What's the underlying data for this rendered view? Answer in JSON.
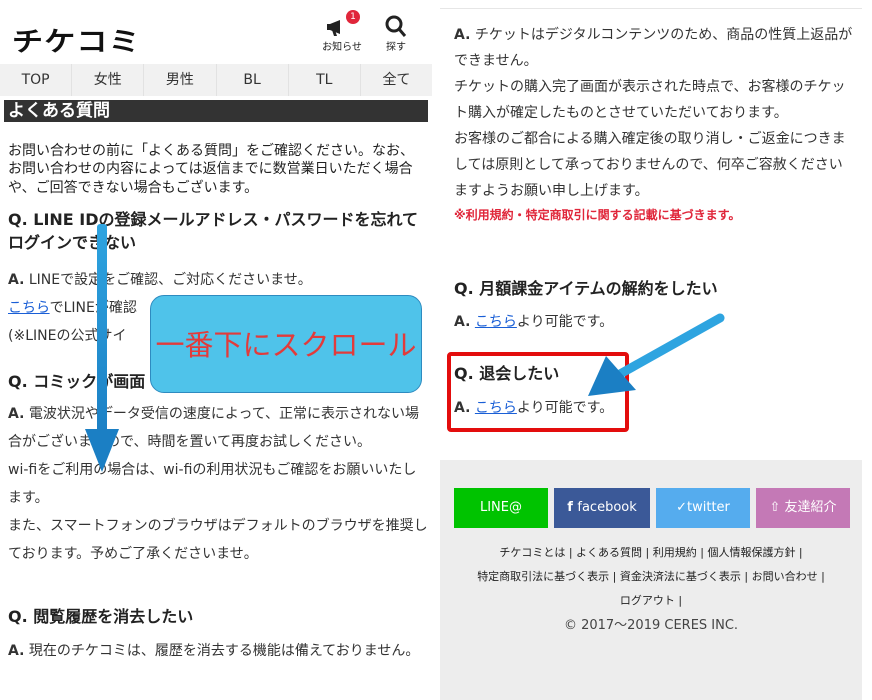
{
  "left": {
    "logo": "チケコミ",
    "header": {
      "notice_label": "お知らせ",
      "notice_badge": "1",
      "search_label": "探す"
    },
    "nav": [
      "TOP",
      "女性",
      "男性",
      "BL",
      "TL",
      "全て"
    ],
    "section_title": "よくある質問",
    "intro": "お問い合わせの前に「よくある質問」をご確認ください。なお、お問い合わせの内容によっては返信までに数営業日いただく場合や、ご回答できない場合もございます。",
    "faq1": {
      "q": "Q. LINE IDの登録メールアドレス・パスワードを忘れてログインできない",
      "a_prefix": "A.",
      "a_line1": " LINEで設定をご確認、ご対応くださいませ。",
      "link": "こちら",
      "a_line2": "でLINEが確認",
      "a_line3": "(※LINEの公式サイ"
    },
    "faq2": {
      "q": "Q. コミックが画面",
      "a_prefix": "A.",
      "a_text": " 電波状況やデータ受信の速度によって、正常に表示されない場合がございますので、時間を置いて再度お試しください。",
      "a_text2": "wi-fiをご利用の場合は、wi-fiの利用状況もご確認をお願いいたします。",
      "a_text3": "また、スマートフォンのブラウザはデフォルトのブラウザを推奨しております。予めご了承くださいませ。"
    },
    "faq3": {
      "q": "Q. 閲覧履歴を消去したい",
      "a_prefix": "A.",
      "a_text": " 現在のチケコミは、履歴を消去する機能は備えておりません。"
    },
    "callout": "一番下にスクロール"
  },
  "right": {
    "refund": {
      "a_prefix": "A.",
      "l1": " チケットはデジタルコンテンツのため、商品の性質上返品ができません。",
      "l2": "チケットの購入完了画面が表示された時点で、お客様のチケット購入が確定したものとさせていただいております。",
      "l3": "お客様のご都合による購入確定後の取り消し・ご返金につきましては原則として承っておりませんので、何卒ご容赦くださいますようお願い申し上げます。",
      "note": "※利用規約・特定商取引に関する記載に基づきます。"
    },
    "faq_sub": {
      "q": "Q. 月額課金アイテムの解約をしたい",
      "a_prefix": "A.",
      "link": "こちら",
      "a_suffix": "より可能です。"
    },
    "faq_withdraw": {
      "q": "Q. 退会したい",
      "a_prefix": "A.",
      "link": "こちら",
      "a_suffix": "より可能です。"
    },
    "social": {
      "line": "LINE@",
      "facebook": "facebook",
      "twitter": "twitter",
      "invite": "友達紹介"
    },
    "footer_links": {
      "row1": "チケコミとは | よくある質問 | 利用規約 | 個人情報保護方針 |",
      "row2": "特定商取引法に基づく表示 | 資金決済法に基づく表示 | お問い合わせ |",
      "row3": "ログアウト |"
    },
    "copyright": "© 2017〜2019 CERES INC.",
    "colors": {
      "line": "#00c300",
      "facebook": "#3b5998",
      "twitter": "#55acee",
      "invite": "#c479b6",
      "highlight": "#e30d0d",
      "callout_bg": "#4fc3ea",
      "callout_text": "#e23b3b"
    }
  }
}
